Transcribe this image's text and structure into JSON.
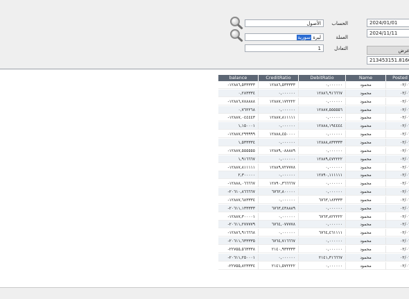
{
  "filters": {
    "date_from": "2024/01/01",
    "date_to": "2024/11/11",
    "account_label": "الحساب",
    "account_value": "الأصول",
    "currency_label": "العملة",
    "currency_value_prefix": "ليرة ",
    "currency_value_selected": "سورية",
    "rate_label": "التعادل",
    "rate_value": "1",
    "show_button_label": "عرض",
    "balance_total": "213453151.816668"
  },
  "grid": {
    "columns": [
      "balance",
      "CreditRatio",
      "DebitRatio",
      "Name",
      "Posted"
    ],
    "rows": [
      [
        "١٢٨٨٦,٥٣٣٣٣٣-",
        "١٢٨٨٦,٥٣٣٣٣٣",
        "٠,٠٠٠٠٠٠",
        "محمود",
        "٠٢/٠١"
      ],
      [
        "٠,٢٨٣٣٣٤",
        "٠,٠٠٠٠٠٠",
        "١٢٨٨٦,٩١٦٦٦٧",
        "محمود",
        "٠٢/٠١"
      ],
      [
        "١٢٨٨٦,٧٨٨٨٨٨-",
        "١٢٨٨٧,١٧٢٢٢٢",
        "٠,٠٠٠٠٠٠",
        "محمود",
        "٠٢/٠١"
      ],
      [
        "٠,٧٦٢٢٦٨",
        "٠,٠٠٠٠٠٠",
        "١٢٨٨٧,٥٥٥٥٥٦",
        "محمود",
        "٠٢/٠١"
      ],
      [
        "١٢٨٨٧,٠٤٤٤٤٣-",
        "١٢٨٨٧,٨١١١١١",
        "٠,٠٠٠٠٠٠",
        "محمود",
        "٠٢/٠١"
      ],
      [
        "١,١٥٠٠٠١",
        "٠,٠٠٠٠٠٠",
        "١٢٨٨٨,١٩٤٤٤٤",
        "محمود",
        "٠٢/٠١"
      ],
      [
        "١٢٨٨٧,٢٩٩٩٩٩-",
        "١٢٨٨٨,٤٥٠٠٠٠",
        "٠,٠٠٠٠٠٠",
        "محمود",
        "٠٢/٠١"
      ],
      [
        "١,٥٣٣٣٣٤",
        "٠,٠٠٠٠٠٠",
        "١٢٨٨٨,٨٣٣٣٣٣",
        "محمود",
        "٠٢/٠١"
      ],
      [
        "١٢٨٨٧,٥٥٥٥٥٥-",
        "١٢٨٨٩,٠٨٨٨٨٩",
        "٠,٠٠٠٠٠٠",
        "محمود",
        "٠٢/٠١"
      ],
      [
        "١,٩١٦٦٦٧",
        "٠,٠٠٠٠٠٠",
        "١٢٨٨٩,٤٧٢٢٢٢",
        "محمود",
        "٠٢/٠١"
      ],
      [
        "١٢٨٨٧,٨١١١١١-",
        "١٢٨٨٩,٧٢٧٧٧٨",
        "٠,٠٠٠٠٠٠",
        "محمود",
        "٠٢/٠١"
      ],
      [
        "٢,٣٠٠٠٠٠",
        "٠,٠٠٠٠٠٠",
        "١٢٨٩٠,١١١١١١",
        "محمود",
        "٠٢/٠١"
      ],
      [
        "١٢٨٨٨,٠٦٦٦٦٧-",
        "١٢٨٩٠,٣٦٦٦٦٧",
        "٠,٠٠٠٠٠٠",
        "محمود",
        "٠٢/٠١"
      ],
      [
        "٢٠٦١٠,٨٦٦٦٦٧-",
        "٦٧٦٢,٨٠٠٠٠٠",
        "٠,٠٠٠٠٠٠",
        "محمود",
        "٠٢/٠١"
      ],
      [
        "١٢٨٨٧,٦٨٣٣٣٤-",
        "٠,٠٠٠٠٠٠",
        "٦٧٦٣,١٨٣٣٣٣",
        "محمود",
        "٠٢/٠١"
      ],
      [
        "٢٠٦١١,١٣٣٣٣٣-",
        "٦٧٦٣,٤٣٨٨٨٩",
        "٠,٠٠٠٠٠٠",
        "محمود",
        "٠٢/٠١"
      ],
      [
        "١٢٨٨٧,٣٠٠٠٠١-",
        "٠,٠٠٠٠٠٠",
        "٦٧٦٣,٨٢٢٢٢٢",
        "محمود",
        "٠٢/٠١"
      ],
      [
        "٢٠٦١١,٢٧٧٧٧٩-",
        "٦٧٦٤,٠٧٧٧٧٨",
        "٠,٠٠٠٠٠٠",
        "محمود",
        "٠٢/٠١"
      ],
      [
        "١٢٨٨٦,٩١٦٦٦٨-",
        "٠,٠٠٠٠٠٠",
        "٦٧٦٤,٤٦١١١١",
        "محمود",
        "٠٢/٠١"
      ],
      [
        "٢٠٦١١,٦٣٣٣٣٥-",
        "٦٧٦٤,٧١٦٦٦٧",
        "٠,٠٠٠٠٠٠",
        "محمود",
        "٠٢/٠١"
      ],
      [
        "٢٢٧٥٥,٥٦٣٣٣٨-",
        "٢١٤٠,٩٣٣٣٣٣",
        "٠,٠٠٠٠٠٠",
        "محمود",
        "٠٢/٠١"
      ],
      [
        "٢٠٦١١,٢٥٠٠٠١-",
        "٠,٠٠٠٠٠٠",
        "٢١٤١,٣١٦٦٦٧",
        "محمود",
        "٠٢/٠١"
      ],
      [
        "٢٢٧٥٥,٨٢٣٣٣٤-",
        "٢١٤١,٥٧٢٢٢٢",
        "٠,٠٠٠٠٠٠",
        "محمود",
        "٠٢/٠١"
      ]
    ]
  }
}
